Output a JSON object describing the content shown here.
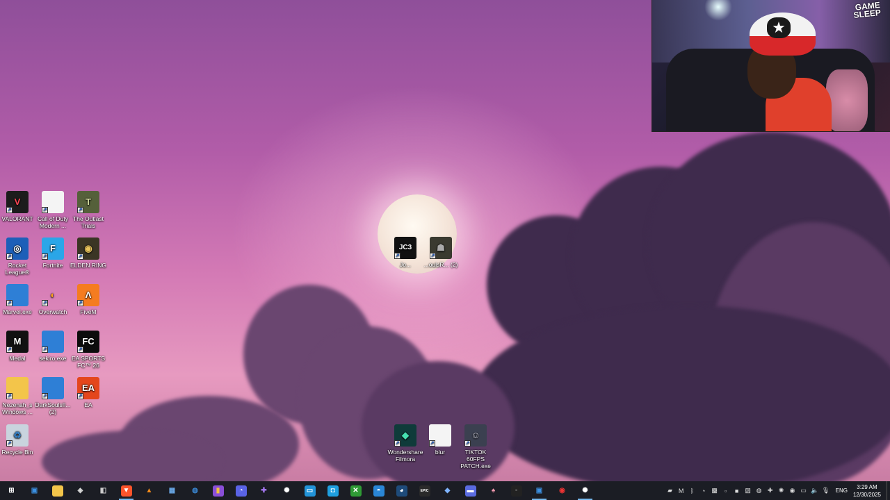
{
  "desktop": {
    "icons": [
      {
        "label": "VALORANT",
        "icon": "valorant-icon",
        "color": "#1c1c1c",
        "glyph": "V",
        "glyph_color": "#ff4655"
      },
      {
        "label": "Call of Duty Modern ...",
        "icon": "file-icon",
        "color": "#f4f4f4",
        "glyph": "",
        "glyph_color": "#333"
      },
      {
        "label": "The Outlast Trials",
        "icon": "outlast-icon",
        "color": "#55603a",
        "glyph": "T",
        "glyph_color": "#d9e2a4"
      },
      {
        "label": "Rocket League®",
        "icon": "rocket-league-icon",
        "color": "#1d5fb8",
        "glyph": "◎",
        "glyph_color": "#fff"
      },
      {
        "label": "Fortnite",
        "icon": "fortnite-icon",
        "color": "#2aa6e8",
        "glyph": "F",
        "glyph_color": "#fff"
      },
      {
        "label": "ELDEN RING",
        "icon": "elden-ring-icon",
        "color": "#3a3524",
        "glyph": "◉",
        "glyph_color": "#e8c45c"
      },
      {
        "label": "Marvel.exe",
        "icon": "exe-window-icon",
        "color": "#2e7fd6",
        "glyph": "",
        "glyph_color": "#fff"
      },
      {
        "label": "Overwatch",
        "icon": "overwatch-icon",
        "color": "transparent",
        "glyph": "◐",
        "glyph_color": "#f99e1a"
      },
      {
        "label": "FiveM",
        "icon": "fivem-icon",
        "color": "#f57c20",
        "glyph": "Λ",
        "glyph_color": "#fff"
      },
      {
        "label": "Medal",
        "icon": "medal-icon",
        "color": "#111",
        "glyph": "M",
        "glyph_color": "#fff"
      },
      {
        "label": "sekiro.exe",
        "icon": "exe-window-icon",
        "color": "#2e7fd6",
        "glyph": "",
        "glyph_color": "#fff"
      },
      {
        "label": "EA SPORTS FC™ 26",
        "icon": "ea-fc-icon",
        "color": "#0c0c0c",
        "glyph": "FC",
        "glyph_color": "#fff"
      },
      {
        "label": "Nezenah_s Windows ...",
        "icon": "folder-icon",
        "color": "#f3c54a",
        "glyph": "",
        "glyph_color": "#fff"
      },
      {
        "label": "DarkSoulsII... (2)",
        "icon": "exe-window-icon",
        "color": "#2e7fd6",
        "glyph": "",
        "glyph_color": "#fff"
      },
      {
        "label": "EA",
        "icon": "ea-icon",
        "color": "#e4461c",
        "glyph": "EA",
        "glyph_color": "#fff"
      },
      {
        "label": "Recycle Bin",
        "icon": "recycle-bin-icon",
        "color": "#c9d4de",
        "glyph": "♻",
        "glyph_color": "#3a7fc0"
      }
    ],
    "center_icons": [
      {
        "label": "Jo...",
        "icon": "just-cause-3-icon",
        "color": "#111",
        "glyph": "JC3",
        "glyph_color": "#fff"
      },
      {
        "label": "...oulsR... (2)",
        "icon": "dark-souls-icon",
        "color": "#3a3a30",
        "glyph": "☗",
        "glyph_color": "#aaa"
      }
    ],
    "bottom_icons": [
      {
        "label": "Wondershare Filmora",
        "icon": "filmora-icon",
        "color": "#0f3b3a",
        "glyph": "◆",
        "glyph_color": "#45e0b0"
      },
      {
        "label": "blur",
        "icon": "file-icon",
        "color": "#f4f4f4",
        "glyph": "",
        "glyph_color": "#333"
      },
      {
        "label": "TIKTOK 60FPS PATCH.exe",
        "icon": "tiktok-patch-icon",
        "color": "#3b4050",
        "glyph": "☺",
        "glyph_color": "#d9d9e6"
      }
    ]
  },
  "webcam": {
    "sign_line1": "GAME",
    "sign_line2": "SLEEP"
  },
  "taskbar": {
    "apps": [
      {
        "name": "start-button",
        "glyph": "⊞",
        "color": "transparent",
        "fg": "#fff",
        "active": false
      },
      {
        "name": "window-app-icon",
        "glyph": "▣",
        "color": "transparent",
        "fg": "#3b8fe0",
        "active": false
      },
      {
        "name": "file-explorer-icon",
        "glyph": "▰",
        "color": "#f3c54a",
        "fg": "#f3c54a",
        "active": false
      },
      {
        "name": "overwolf-icon",
        "glyph": "◈",
        "color": "transparent",
        "fg": "#ddd",
        "active": false
      },
      {
        "name": "app-launcher-icon",
        "glyph": "◧",
        "color": "transparent",
        "fg": "#ccc",
        "active": false
      },
      {
        "name": "brave-browser-icon",
        "glyph": "▼",
        "color": "#fb542b",
        "fg": "#fff",
        "active": true
      },
      {
        "name": "vlc-icon",
        "glyph": "▲",
        "color": "transparent",
        "fg": "#f28a1a",
        "active": false
      },
      {
        "name": "photos-app-icon",
        "glyph": "▦",
        "color": "transparent",
        "fg": "#6aa9e8",
        "active": false
      },
      {
        "name": "globe-app-icon",
        "glyph": "◍",
        "color": "transparent",
        "fg": "#3a86d1",
        "active": false
      },
      {
        "name": "color-app-icon",
        "glyph": "▮",
        "color": "#8a4fd8",
        "fg": "#f0c040",
        "active": false
      },
      {
        "name": "discord-like-icon",
        "glyph": "◔",
        "color": "#5a63e6",
        "fg": "#fff",
        "active": false
      },
      {
        "name": "gamepad-icon",
        "glyph": "✚",
        "color": "transparent",
        "fg": "#a678f2",
        "active": false
      },
      {
        "name": "settings-gear-icon",
        "glyph": "✺",
        "color": "transparent",
        "fg": "#fff",
        "active": false
      },
      {
        "name": "monitor-app-icon",
        "glyph": "▭",
        "color": "#2294d9",
        "fg": "#fff",
        "active": false
      },
      {
        "name": "store-app-icon",
        "glyph": "◘",
        "color": "#1fa0e0",
        "fg": "#fff",
        "active": false
      },
      {
        "name": "xbox-icon",
        "glyph": "✕",
        "color": "#2f9b35",
        "fg": "#fff",
        "active": false
      },
      {
        "name": "edge-like-icon",
        "glyph": "◓",
        "color": "#2a86d6",
        "fg": "#fff",
        "active": false
      },
      {
        "name": "steam-icon",
        "glyph": "◕",
        "color": "#1e4b7a",
        "fg": "#fff",
        "active": false
      },
      {
        "name": "epic-games-icon",
        "glyph": "EPIC",
        "color": "#2a2a2a",
        "fg": "#fff",
        "active": false
      },
      {
        "name": "diamond-app-icon",
        "glyph": "◆",
        "color": "transparent",
        "fg": "#7fb4ff",
        "active": false
      },
      {
        "name": "blue-window-icon",
        "glyph": "▬",
        "color": "#5a6be0",
        "fg": "#fff",
        "active": false
      },
      {
        "name": "pink-app-icon",
        "glyph": "♠",
        "color": "transparent",
        "fg": "#f59ab0",
        "active": false
      },
      {
        "name": "dark-app-icon",
        "glyph": "▪",
        "color": "#222",
        "fg": "#555",
        "active": false
      },
      {
        "name": "exe-window-icon",
        "glyph": "▣",
        "color": "transparent",
        "fg": "#3b8fe0",
        "active": true
      },
      {
        "name": "record-app-icon",
        "glyph": "◉",
        "color": "transparent",
        "fg": "#e33",
        "active": false
      },
      {
        "name": "steelseries-icon",
        "glyph": "✺",
        "color": "transparent",
        "fg": "#fff",
        "active": true
      }
    ],
    "tray": [
      {
        "name": "tray-app-1-icon",
        "glyph": "▰"
      },
      {
        "name": "tray-medal-icon",
        "glyph": "M"
      },
      {
        "name": "tray-bluetooth-icon",
        "glyph": "ᛒ"
      },
      {
        "name": "tray-discord-icon",
        "glyph": "◔"
      },
      {
        "name": "tray-app-2-icon",
        "glyph": "▩"
      },
      {
        "name": "tray-app-3-icon",
        "glyph": "▫"
      },
      {
        "name": "tray-nvidia-icon",
        "glyph": "■"
      },
      {
        "name": "tray-app-4-icon",
        "glyph": "▧"
      },
      {
        "name": "tray-vpn-icon",
        "glyph": "◍"
      },
      {
        "name": "tray-gamepad-icon",
        "glyph": "✚"
      },
      {
        "name": "tray-steelseries-icon",
        "glyph": "✺"
      },
      {
        "name": "tray-app-5-icon",
        "glyph": "◉"
      },
      {
        "name": "tray-network-icon",
        "glyph": "▭"
      },
      {
        "name": "tray-volume-icon",
        "glyph": "🔈"
      },
      {
        "name": "tray-mic-icon",
        "glyph": "🎙"
      }
    ],
    "language": "ENG",
    "time": "3:29 AM",
    "date": "12/30/2025"
  }
}
